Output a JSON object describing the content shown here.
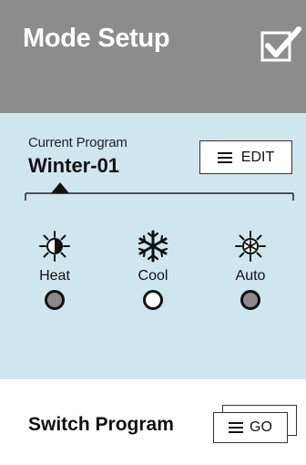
{
  "header": {
    "title": "Mode Setup",
    "check_icon": "checkbox-check-icon",
    "bg_color": "#8c8c8c"
  },
  "program": {
    "label": "Current Program",
    "name": "Winter-01",
    "edit_label": "EDIT",
    "edit_icon": "menu-lines-icon"
  },
  "modes": [
    {
      "key": "heat",
      "label": "Heat",
      "icon": "sun-snowflake-icon",
      "selected": false
    },
    {
      "key": "cool",
      "label": "Cool",
      "icon": "snowflake-icon",
      "selected": true
    },
    {
      "key": "auto",
      "label": "Auto",
      "icon": "sun-snowflake-auto-icon",
      "selected": false
    }
  ],
  "footer": {
    "switch_label": "Switch Program",
    "go_label": "GO",
    "go_icon": "menu-lines-icon"
  },
  "colors": {
    "main_bg": "#cfe6ef",
    "dot_off": "#8a8a8a",
    "dot_on": "#ffffff"
  }
}
